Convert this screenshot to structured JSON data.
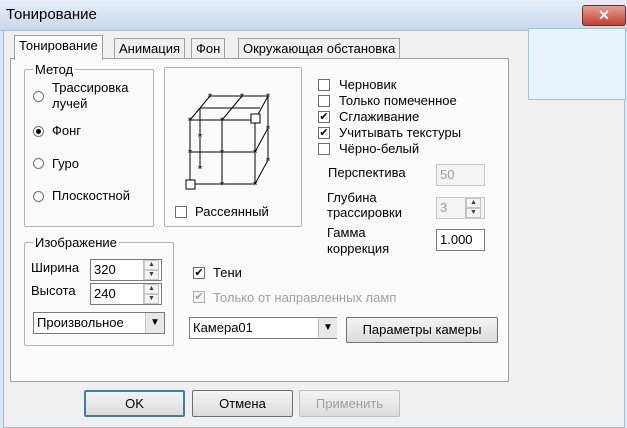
{
  "window": {
    "title": "Тонирование",
    "close_glyph": "✕"
  },
  "tabs": [
    "Тонирование",
    "Анимация",
    "Фон",
    "Окружающая обстановка"
  ],
  "method": {
    "legend": "Метод",
    "options": [
      {
        "label_line1": "Трассировка",
        "label_line2": "лучей",
        "selected": false
      },
      {
        "label": "Фонг",
        "selected": true
      },
      {
        "label": "Гуро",
        "selected": false
      },
      {
        "label": "Плоскостной",
        "selected": false
      }
    ]
  },
  "diffuse": {
    "label": "Рассеянный",
    "checked": false
  },
  "options": [
    {
      "label": "Черновик",
      "checked": false
    },
    {
      "label": "Только помеченное",
      "checked": false
    },
    {
      "label": "Сглаживание",
      "checked": true
    },
    {
      "label": "Учитывать текстуры",
      "checked": true
    },
    {
      "label": "Чёрно-белый",
      "checked": false
    }
  ],
  "perspective": {
    "label": "Перспектива",
    "value": "50"
  },
  "depth": {
    "label_line1": "Глубина",
    "label_line2": "трассировки",
    "value": "3"
  },
  "gamma": {
    "label_line1": "Гамма",
    "label_line2": "коррекция",
    "value": "1.000"
  },
  "image": {
    "legend": "Изображение",
    "width_label": "Ширина",
    "width_value": "320",
    "height_label": "Высота",
    "height_value": "240",
    "size_mode": "Произвольное"
  },
  "shadows": {
    "label": "Тени",
    "checked": true
  },
  "directional_only": {
    "label": "Только от направленных ламп",
    "checked": true
  },
  "camera": {
    "value": "Камера01",
    "params_button": "Параметры камеры"
  },
  "buttons": {
    "ok": "OK",
    "cancel": "Отмена",
    "apply": "Применить"
  },
  "glyphs": {
    "check": "✔",
    "arrow_down": "▼",
    "arrow_up_small": "▲",
    "arrow_down_small": "▼"
  }
}
